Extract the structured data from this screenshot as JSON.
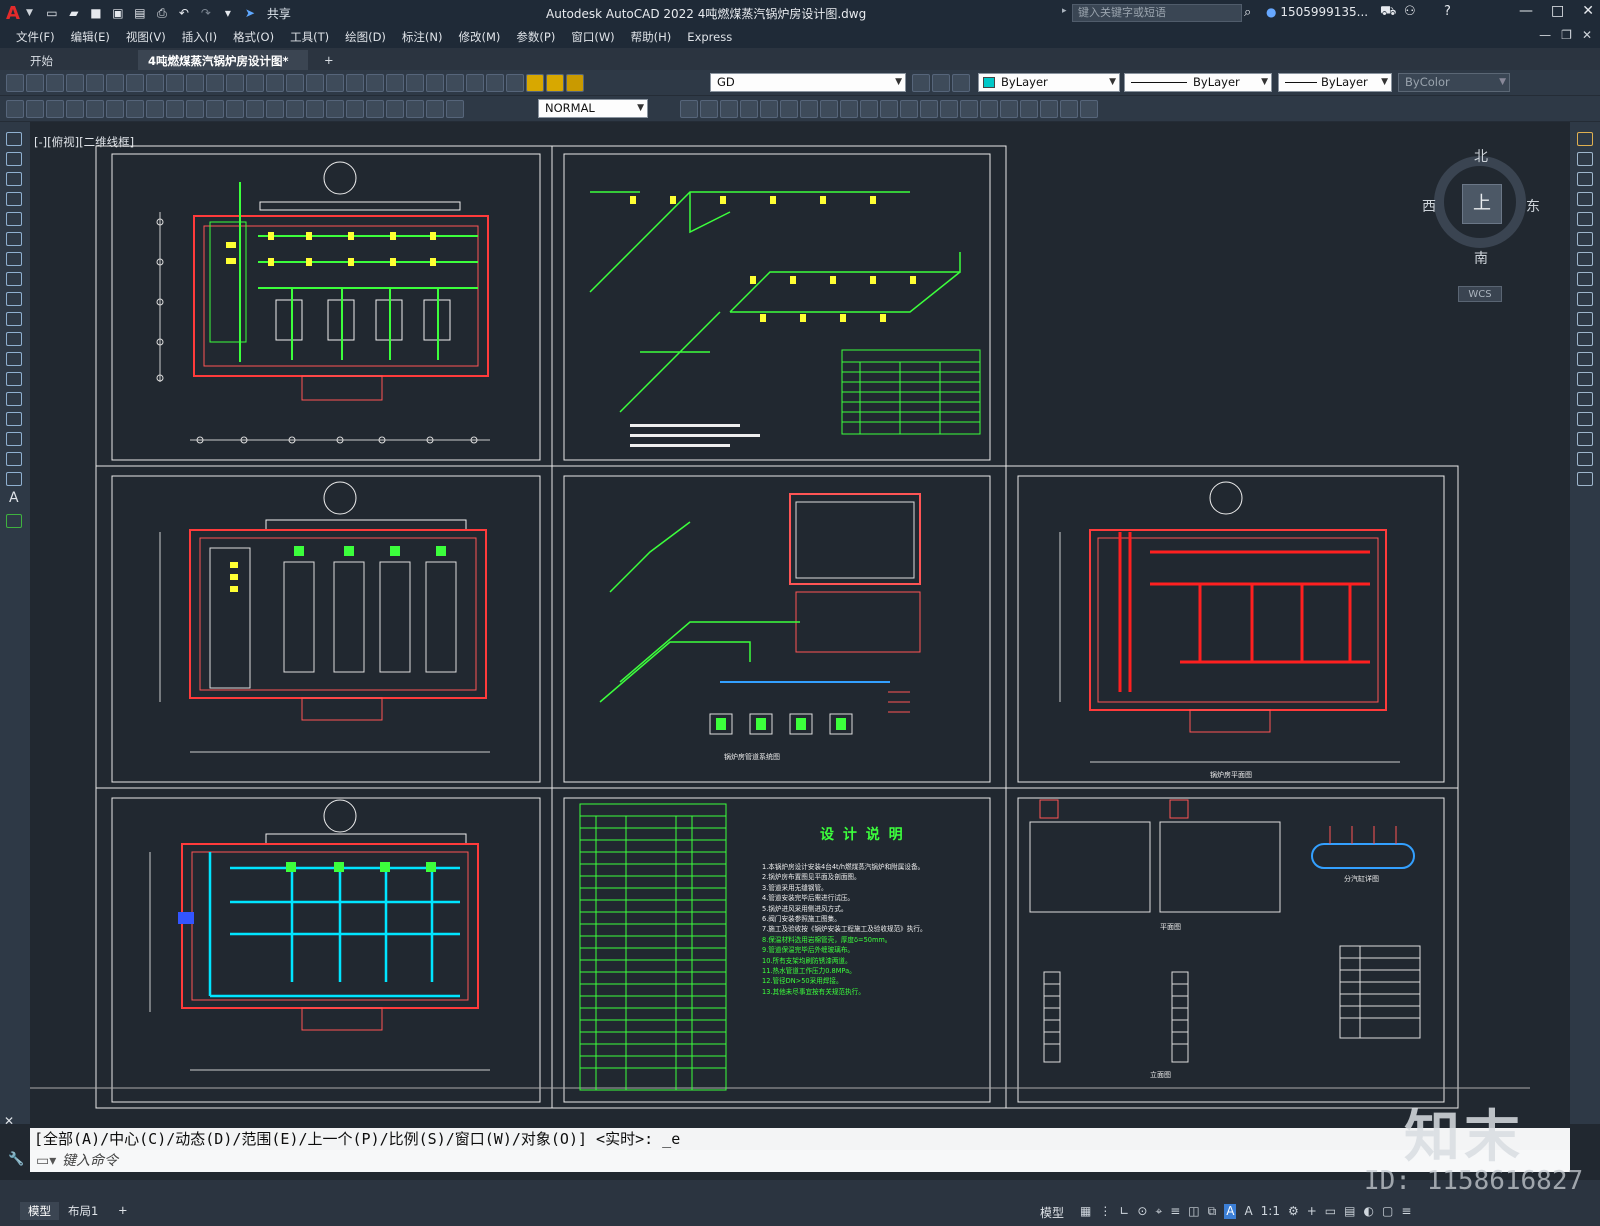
{
  "app": {
    "logo": "A",
    "title": "Autodesk AutoCAD 2022    4吨燃煤蒸汽锅炉房设计图.dwg",
    "share": "共享",
    "search_placeholder": "键入关键字或短语",
    "user": "1505999135...",
    "window_controls": [
      "—",
      "□",
      "✕"
    ]
  },
  "menu": [
    "文件(F)",
    "编辑(E)",
    "视图(V)",
    "插入(I)",
    "格式(O)",
    "工具(T)",
    "绘图(D)",
    "标注(N)",
    "修改(M)",
    "参数(P)",
    "窗口(W)",
    "帮助(H)",
    "Express"
  ],
  "tabs": {
    "start": "开始",
    "doc": "4吨燃煤蒸汽锅炉房设计图*",
    "close": "✕",
    "add": "+"
  },
  "toolbar": {
    "layer": "GD",
    "color": "ByLayer",
    "linetype": "ByLayer",
    "lineweight": "ByLayer",
    "plotstyle": "ByColor",
    "dimstyle": "NORMAL"
  },
  "viewport": {
    "label": "[-][俯视][二维线框]",
    "compass": {
      "n": "北",
      "s": "南",
      "e": "东",
      "w": "西",
      "top": "上",
      "wcs": "WCS"
    }
  },
  "drawing": {
    "explain_title": "设 计 说 明",
    "notes": [
      "1.本锅炉房设计安装4台4t/h燃煤蒸汽锅炉和附属设备。",
      "2.锅炉房布置图见平面及剖面图。",
      "3.管道采用无缝钢管。",
      "4.管道安装完毕后需进行试压。",
      "5.锅炉进风采用侧进风方式。",
      "6.阀门安装参照施工图集。",
      "7.施工及验收按《锅炉安装工程施工及验收规范》执行。",
      "8.保温材料选用岩棉管壳，厚度δ=50mm。",
      "9.管道保温完毕后外缠玻璃布。",
      "10.所有支架均刷防锈漆两道。",
      "11.热水管道工作压力0.8MPa。",
      "12.管径DN>50采用焊接。",
      "13.其他未尽事宜按有关规范执行。"
    ],
    "drawing_titles": {
      "sheet2": "锅炉房管道系统图",
      "sheet5": "锅炉房管道系统图",
      "sheet6": "锅炉房平面图",
      "sheet9_a": "分汽缸详图",
      "sheet9_b": "平面图",
      "sheet9_c": "立面图"
    }
  },
  "command": {
    "history": "[全部(A)/中心(C)/动态(D)/范围(E)/上一个(P)/比例(S)/窗口(W)/对象(O)] <实时>: _e",
    "input_placeholder": "键入命令"
  },
  "status": {
    "model_tab": "模型",
    "layout_tab": "布局1",
    "add": "+",
    "model_label": "模型",
    "scale": "1:1"
  },
  "watermark": {
    "logo": "知末",
    "id": "ID: 1158616827"
  }
}
